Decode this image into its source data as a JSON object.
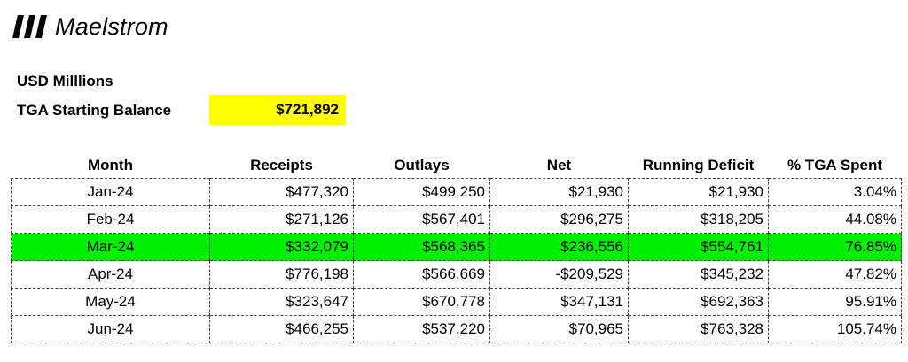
{
  "brand": {
    "name": "Maelstrom",
    "logo_icon": "three-slash-bars-icon"
  },
  "units_label": "USD Milllions",
  "balance": {
    "label": "TGA Starting Balance",
    "value": "$721,892",
    "highlight_color": "#ffff00"
  },
  "table": {
    "headers": [
      "Month",
      "Receipts",
      "Outlays",
      "Net",
      "Running Deficit",
      "% TGA Spent"
    ],
    "highlight_color": "#00ee00",
    "rows": [
      {
        "month": "Jan-24",
        "receipts": "$477,320",
        "outlays": "$499,250",
        "net": "$21,930",
        "running_deficit": "$21,930",
        "pct_spent": "3.04%",
        "highlighted": false
      },
      {
        "month": "Feb-24",
        "receipts": "$271,126",
        "outlays": "$567,401",
        "net": "$296,275",
        "running_deficit": "$318,205",
        "pct_spent": "44.08%",
        "highlighted": false
      },
      {
        "month": "Mar-24",
        "receipts": "$332,079",
        "outlays": "$568,365",
        "net": "$236,556",
        "running_deficit": "$554,761",
        "pct_spent": "76.85%",
        "highlighted": true
      },
      {
        "month": "Apr-24",
        "receipts": "$776,198",
        "outlays": "$566,669",
        "net": "-$209,529",
        "running_deficit": "$345,232",
        "pct_spent": "47.82%",
        "highlighted": false
      },
      {
        "month": "May-24",
        "receipts": "$323,647",
        "outlays": "$670,778",
        "net": "$347,131",
        "running_deficit": "$692,363",
        "pct_spent": "95.91%",
        "highlighted": false
      },
      {
        "month": "Jun-24",
        "receipts": "$466,255",
        "outlays": "$537,220",
        "net": "$70,965",
        "running_deficit": "$763,328",
        "pct_spent": "105.74%",
        "highlighted": false
      }
    ]
  }
}
